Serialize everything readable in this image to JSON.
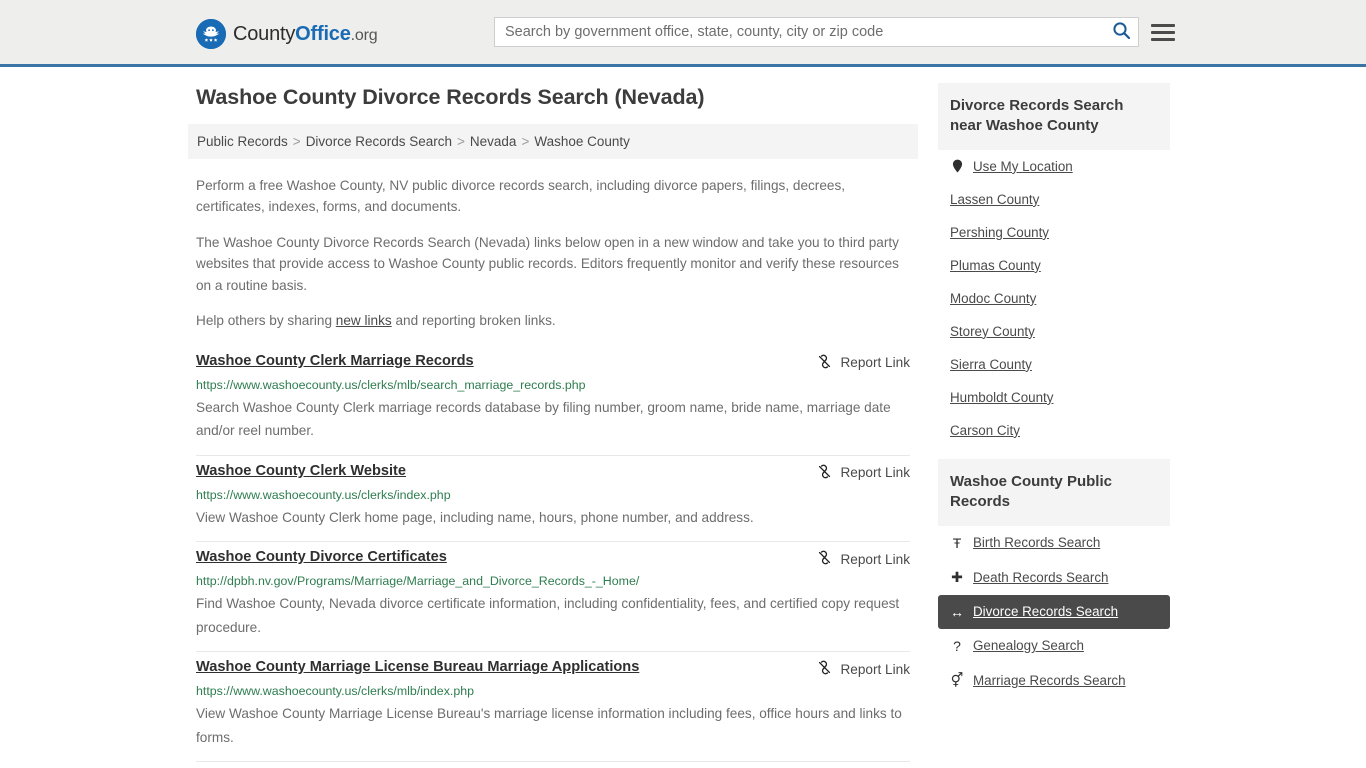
{
  "header": {
    "brand": {
      "part1": "County",
      "part2": "Office",
      "tld": ".org"
    },
    "search": {
      "placeholder": "Search by government office, state, county, city or zip code",
      "value": ""
    },
    "search_icon": "search-icon",
    "menu_icon": "hamburger-menu-icon",
    "accent_color": "#3a74a6"
  },
  "main": {
    "title": "Washoe County Divorce Records Search (Nevada)",
    "breadcrumb": [
      "Public Records",
      "Divorce Records Search",
      "Nevada",
      "Washoe County"
    ],
    "breadcrumb_separator": ">",
    "intro": {
      "p1": "Perform a free Washoe County, NV public divorce records search, including divorce papers, filings, decrees, certificates, indexes, forms, and documents.",
      "p2": "The Washoe County Divorce Records Search (Nevada) links below open in a new window and take you to third party websites that provide access to Washoe County public records. Editors frequently monitor and verify these resources on a routine basis.",
      "p3_before": "Help others by sharing ",
      "p3_link": "new links",
      "p3_after": " and reporting broken links."
    },
    "report_label": "Report Link",
    "results": [
      {
        "title": "Washoe County Clerk Marriage Records",
        "url": "https://www.washoecounty.us/clerks/mlb/search_marriage_records.php",
        "description": "Search Washoe County Clerk marriage records database by filing number, groom name, bride name, marriage date and/or reel number."
      },
      {
        "title": "Washoe County Clerk Website",
        "url": "https://www.washoecounty.us/clerks/index.php",
        "description": "View Washoe County Clerk home page, including name, hours, phone number, and address."
      },
      {
        "title": "Washoe County Divorce Certificates",
        "url": "http://dpbh.nv.gov/Programs/Marriage/Marriage_and_Divorce_Records_-_Home/",
        "description": "Find Washoe County, Nevada divorce certificate information, including confidentiality, fees, and certified copy request procedure."
      },
      {
        "title": "Washoe County Marriage License Bureau Marriage Applications",
        "url": "https://www.washoecounty.us/clerks/mlb/index.php",
        "description": "View Washoe County Marriage License Bureau's marriage license information including fees, office hours and links to forms."
      }
    ]
  },
  "sidebar": {
    "nearby": {
      "heading": "Divorce Records Search near Washoe County",
      "items": [
        {
          "label": "Use My Location",
          "icon": "map-pin-icon"
        },
        {
          "label": "Lassen County",
          "icon": ""
        },
        {
          "label": "Pershing County",
          "icon": ""
        },
        {
          "label": "Plumas County",
          "icon": ""
        },
        {
          "label": "Modoc County",
          "icon": ""
        },
        {
          "label": "Storey County",
          "icon": ""
        },
        {
          "label": "Sierra County",
          "icon": ""
        },
        {
          "label": "Humboldt County",
          "icon": ""
        },
        {
          "label": "Carson City",
          "icon": ""
        }
      ]
    },
    "public_records": {
      "heading": "Washoe County Public Records",
      "items": [
        {
          "label": "Birth Records Search",
          "icon": "baby-icon",
          "glyph": "Ŧ",
          "active": false
        },
        {
          "label": "Death Records Search",
          "icon": "cross-icon",
          "glyph": "✚",
          "active": false
        },
        {
          "label": "Divorce Records Search",
          "icon": "left-right-arrow-icon",
          "glyph": "↔",
          "active": true
        },
        {
          "label": "Genealogy Search",
          "icon": "question-mark-icon",
          "glyph": "?",
          "active": false
        },
        {
          "label": "Marriage Records Search",
          "icon": "gender-symbols-icon",
          "glyph": "⚥",
          "active": false
        }
      ]
    }
  }
}
